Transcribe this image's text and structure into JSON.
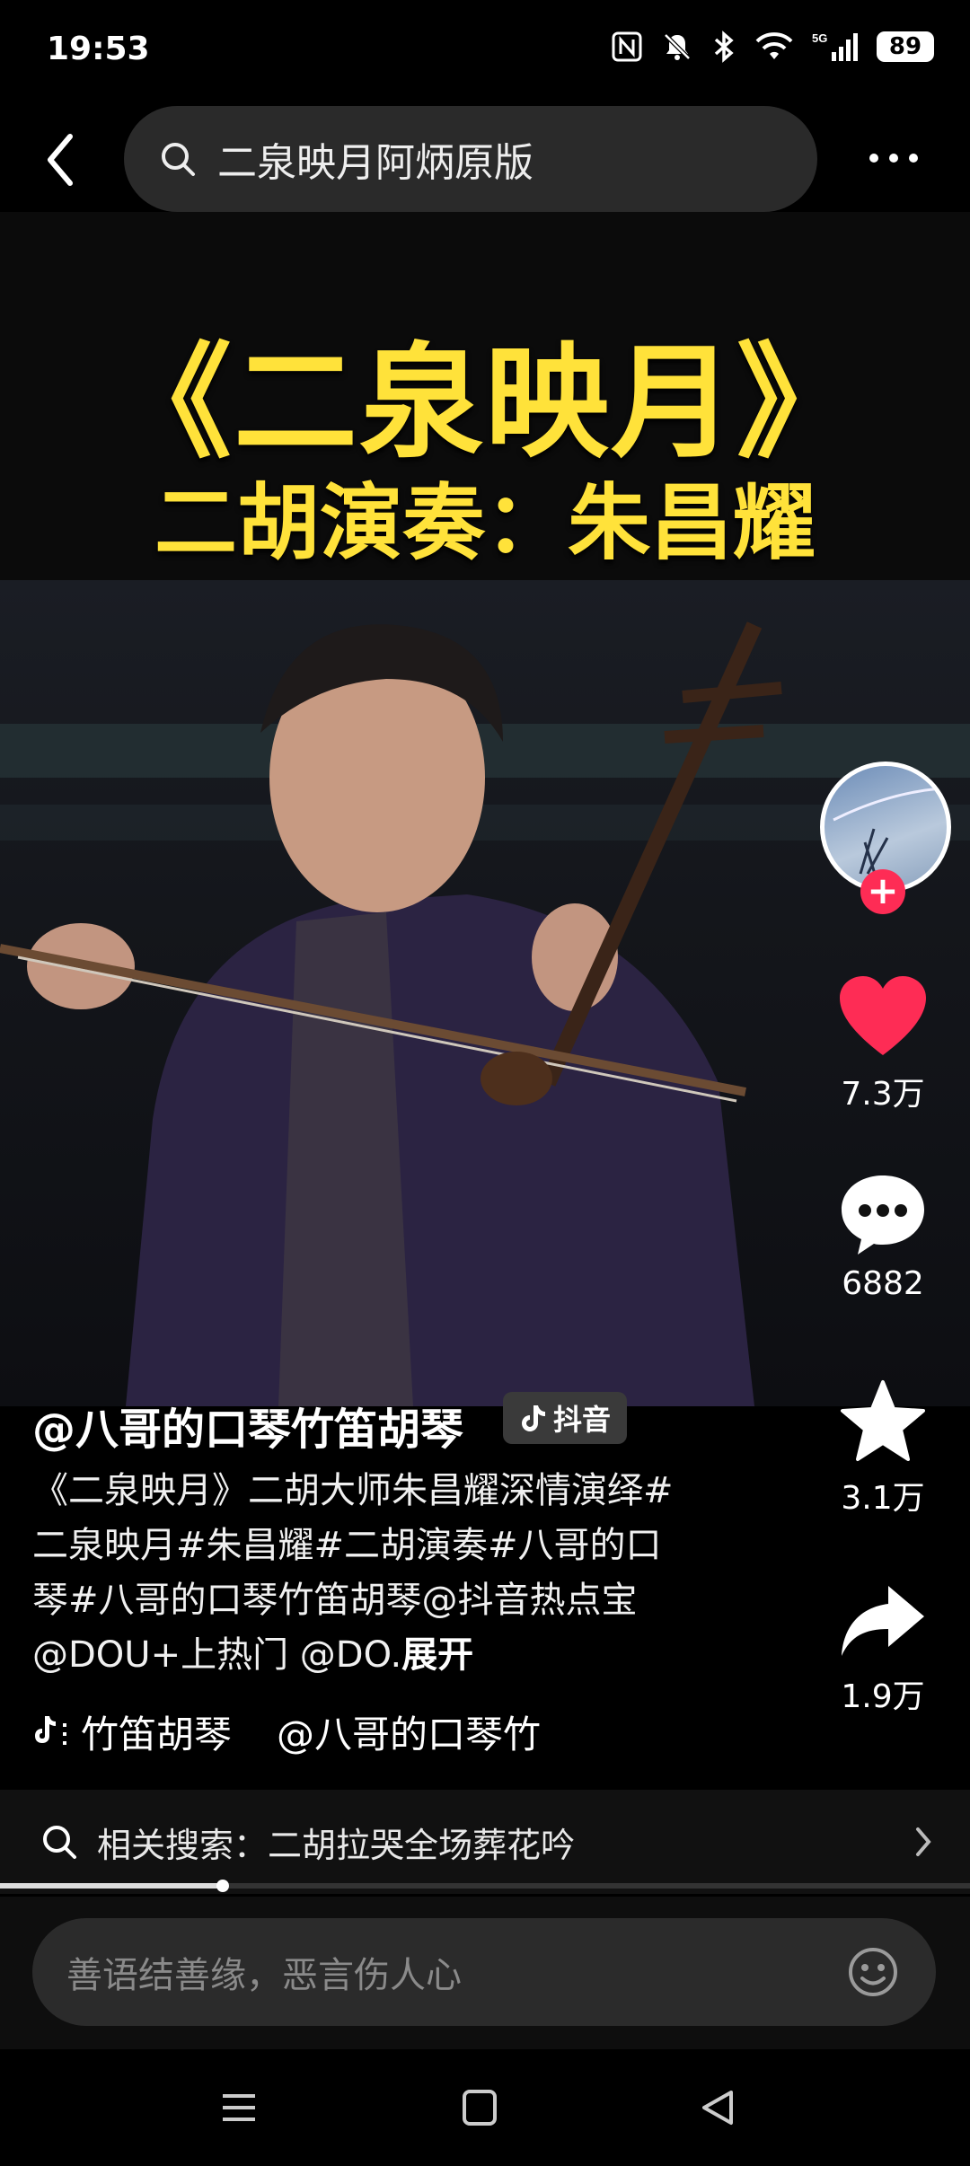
{
  "status_bar": {
    "time": "19:53",
    "battery": "89",
    "network": "5G"
  },
  "search": {
    "query": "二泉映月阿炳原版"
  },
  "video": {
    "title_main": "《二泉映月》",
    "title_sub": "二胡演奏：朱昌耀"
  },
  "actions": {
    "like_count": "7.3万",
    "comment_count": "6882",
    "favorite_count": "3.1万",
    "share_count": "1.9万",
    "like_color": "#fe2c55"
  },
  "caption": {
    "author": "@八哥的口琴竹笛胡琴",
    "platform_tag": "抖音",
    "description": "《二泉映月》二胡大师朱昌耀深情演绎#二泉映月#朱昌耀#二胡演奏#八哥的口琴#八哥的口琴竹笛胡琴@抖音热点宝 @DOU+上热门 @DO.",
    "expand_label": "展开",
    "music": "竹笛胡琴",
    "music_mention": "@八哥的口琴竹"
  },
  "related_search": {
    "label": "相关搜索：二胡拉哭全场葬花吟"
  },
  "progress": {
    "fraction": 0.23
  },
  "comment": {
    "placeholder": "善语结善缘，恶言伤人心"
  }
}
